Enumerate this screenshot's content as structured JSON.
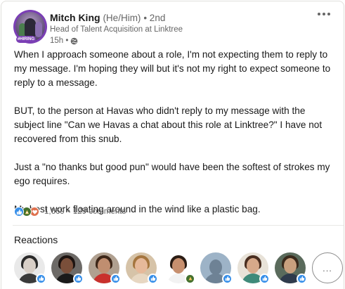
{
  "author": {
    "name": "Mitch King",
    "pronouns": "(He/Him)",
    "degree": "• 2nd",
    "headline": "Head of Talent Acquisition at Linktree",
    "time": "15h •",
    "avatar_badge": "#HIRING"
  },
  "post": {
    "paragraphs": [
      "When I approach someone about a role, I'm not expecting them to reply to my message. I'm hoping they will but it's not my right to expect someone to reply to a message.",
      "BUT, to the person at Havas who didn't reply to my message with the subject line \"Can we Havas a chat about this role at Linktree?\" I have not recovered from this snub.",
      "Just a \"no thanks but good pun\" would have been the softest of strokes my ego requires.",
      "My best work floating around in the wind like a plastic bag."
    ]
  },
  "social": {
    "reaction_count": "1,669",
    "separator": "•",
    "comments": "129 comments",
    "reaction_types": [
      "like-icon",
      "celebrate-icon",
      "love-icon"
    ]
  },
  "reactions": {
    "title": "Reactions",
    "more_label": "..."
  },
  "colors": {
    "like": "#378fe9",
    "celebrate": "#44712e",
    "love": "#df704d",
    "hiring_ring": "#7b3fb5"
  }
}
